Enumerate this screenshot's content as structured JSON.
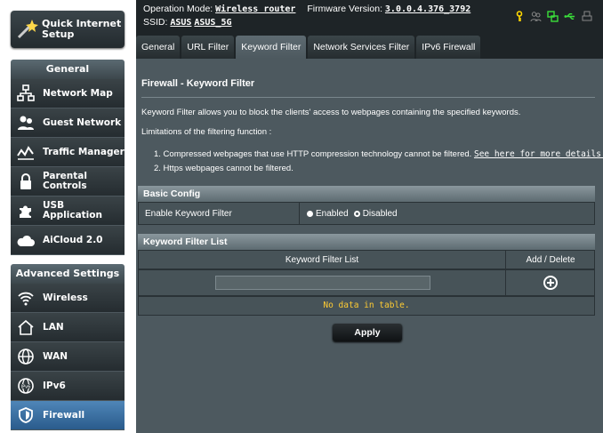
{
  "sidebar": {
    "quick_setup": "Quick Internet Setup",
    "general_header": "General",
    "general_items": [
      {
        "label": "Network Map",
        "icon": "network-map-icon"
      },
      {
        "label": "Guest Network",
        "icon": "guest-network-icon"
      },
      {
        "label": "Traffic Manager",
        "icon": "traffic-manager-icon"
      },
      {
        "label": "Parental Controls",
        "icon": "lock-icon"
      },
      {
        "label": "USB Application",
        "icon": "puzzle-icon"
      },
      {
        "label": "AiCloud 2.0",
        "icon": "cloud-icon"
      }
    ],
    "advanced_header": "Advanced Settings",
    "advanced_items": [
      {
        "label": "Wireless",
        "icon": "wifi-icon"
      },
      {
        "label": "LAN",
        "icon": "home-icon"
      },
      {
        "label": "WAN",
        "icon": "globe-icon"
      },
      {
        "label": "IPv6",
        "icon": "ipv6-globe-icon"
      },
      {
        "label": "Firewall",
        "icon": "shield-icon"
      }
    ]
  },
  "header": {
    "operation_mode_label": "Operation Mode:",
    "operation_mode": "Wireless router",
    "firmware_label": "Firmware Version:",
    "firmware": "3.0.0.4.376_3792",
    "ssid_label": "SSID:",
    "ssid1": "ASUS",
    "ssid2": "ASUS_5G"
  },
  "tabs": [
    "General",
    "URL Filter",
    "Keyword Filter",
    "Network Services Filter",
    "IPv6 Firewall"
  ],
  "active_tab": "Keyword Filter",
  "content": {
    "title": "Firewall - Keyword Filter",
    "intro": "Keyword Filter allows you to block the clients' access to webpages containing the specified keywords.",
    "limitations": "Limitations of the filtering function :",
    "note1": "1.  Compressed webpages that use HTTP compression technology cannot be filtered.",
    "note1_link": "See here for more details.",
    "note2": "2.  Https webpages cannot be filtered.",
    "basic_config_header": "Basic Config",
    "enable_label": "Enable Keyword Filter",
    "enabled_option": "Enabled",
    "disabled_option": "Disabled",
    "list_header": "Keyword Filter List",
    "col_list": "Keyword Filter List",
    "col_add_delete": "Add / Delete",
    "no_data": "No data in table.",
    "apply": "Apply"
  },
  "colors": {
    "panel": "#4d595f",
    "active_menu": "#3d6e9f",
    "no_data_text": "#ffcc33"
  }
}
